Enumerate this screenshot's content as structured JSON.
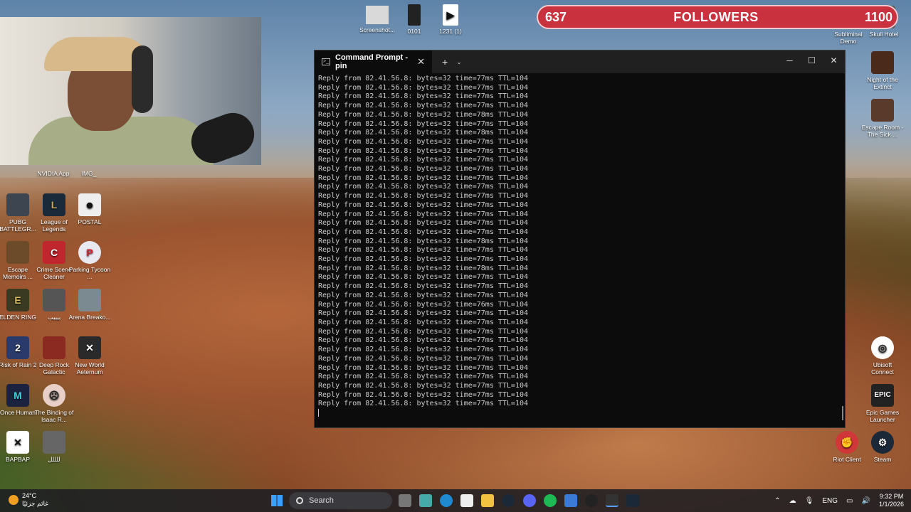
{
  "followers": {
    "count_left": "637",
    "label": "FOLLOWERS",
    "count_right": "1100"
  },
  "desktop_icons_top": [
    {
      "label": "Screenshot..."
    },
    {
      "label": "0101"
    },
    {
      "label": "1231 (1)"
    },
    {
      "label": "Subliminal Demo"
    },
    {
      "label": "Skull Hotel"
    }
  ],
  "desktop_icons_left": [
    {
      "label": "NVIDIA App"
    },
    {
      "label": "IMG_"
    },
    {
      "label": "PUBG BATTLEGR..."
    },
    {
      "label": "League of Legends"
    },
    {
      "label": "POSTAL"
    },
    {
      "label": "Escape Memoirs ..."
    },
    {
      "label": "Crime Scene Cleaner"
    },
    {
      "label": "Parking Tycoon ..."
    },
    {
      "label": "ELDEN RING"
    },
    {
      "label": "ببببب"
    },
    {
      "label": "Arena Breako..."
    },
    {
      "label": "Risk of Rain 2"
    },
    {
      "label": "Deep Rock Galactic"
    },
    {
      "label": "New World Aeternum"
    },
    {
      "label": "Once Human"
    },
    {
      "label": "The Binding of Isaac R..."
    },
    {
      "label": "BAPBAP"
    },
    {
      "label": "للللل"
    }
  ],
  "desktop_icons_right": [
    {
      "label": "Night of the Extinct"
    },
    {
      "label": "Escape Room - The Sick ..."
    },
    {
      "label": "Ubisoft Connect"
    },
    {
      "label": "Epic Games Launcher"
    },
    {
      "label": "Riot Client"
    },
    {
      "label": "Steam"
    }
  ],
  "terminal": {
    "tab_title": "Command Prompt - pin",
    "new_tab": "+",
    "lines": [
      "Reply from 82.41.56.8: bytes=32 time=77ms TTL=104",
      "Reply from 82.41.56.8: bytes=32 time=77ms TTL=104",
      "Reply from 82.41.56.8: bytes=32 time=77ms TTL=104",
      "Reply from 82.41.56.8: bytes=32 time=77ms TTL=104",
      "Reply from 82.41.56.8: bytes=32 time=78ms TTL=104",
      "Reply from 82.41.56.8: bytes=32 time=77ms TTL=104",
      "Reply from 82.41.56.8: bytes=32 time=78ms TTL=104",
      "Reply from 82.41.56.8: bytes=32 time=77ms TTL=104",
      "Reply from 82.41.56.8: bytes=32 time=77ms TTL=104",
      "Reply from 82.41.56.8: bytes=32 time=77ms TTL=104",
      "Reply from 82.41.56.8: bytes=32 time=77ms TTL=104",
      "Reply from 82.41.56.8: bytes=32 time=77ms TTL=104",
      "Reply from 82.41.56.8: bytes=32 time=77ms TTL=104",
      "Reply from 82.41.56.8: bytes=32 time=77ms TTL=104",
      "Reply from 82.41.56.8: bytes=32 time=77ms TTL=104",
      "Reply from 82.41.56.8: bytes=32 time=77ms TTL=104",
      "Reply from 82.41.56.8: bytes=32 time=77ms TTL=104",
      "Reply from 82.41.56.8: bytes=32 time=77ms TTL=104",
      "Reply from 82.41.56.8: bytes=32 time=78ms TTL=104",
      "Reply from 82.41.56.8: bytes=32 time=77ms TTL=104",
      "Reply from 82.41.56.8: bytes=32 time=77ms TTL=104",
      "Reply from 82.41.56.8: bytes=32 time=78ms TTL=104",
      "Reply from 82.41.56.8: bytes=32 time=77ms TTL=104",
      "Reply from 82.41.56.8: bytes=32 time=77ms TTL=104",
      "Reply from 82.41.56.8: bytes=32 time=77ms TTL=104",
      "Reply from 82.41.56.8: bytes=32 time=76ms TTL=104",
      "Reply from 82.41.56.8: bytes=32 time=77ms TTL=104",
      "Reply from 82.41.56.8: bytes=32 time=77ms TTL=104",
      "Reply from 82.41.56.8: bytes=32 time=77ms TTL=104",
      "Reply from 82.41.56.8: bytes=32 time=77ms TTL=104",
      "Reply from 82.41.56.8: bytes=32 time=77ms TTL=104",
      "Reply from 82.41.56.8: bytes=32 time=77ms TTL=104",
      "Reply from 82.41.56.8: bytes=32 time=77ms TTL=104",
      "Reply from 82.41.56.8: bytes=32 time=77ms TTL=104",
      "Reply from 82.41.56.8: bytes=32 time=77ms TTL=104",
      "Reply from 82.41.56.8: bytes=32 time=77ms TTL=104",
      "Reply from 82.41.56.8: bytes=32 time=77ms TTL=104"
    ]
  },
  "taskbar": {
    "weather_temp": "24°C",
    "weather_desc": "غائم جزئيًا",
    "search_placeholder": "Search",
    "lang": "ENG",
    "time": "9:32 PM",
    "date": "1/1/2026"
  },
  "colors": {
    "followers_bg": "#c8313d",
    "terminal_bg": "#0c0c0c",
    "terminal_text": "#cccccc"
  }
}
